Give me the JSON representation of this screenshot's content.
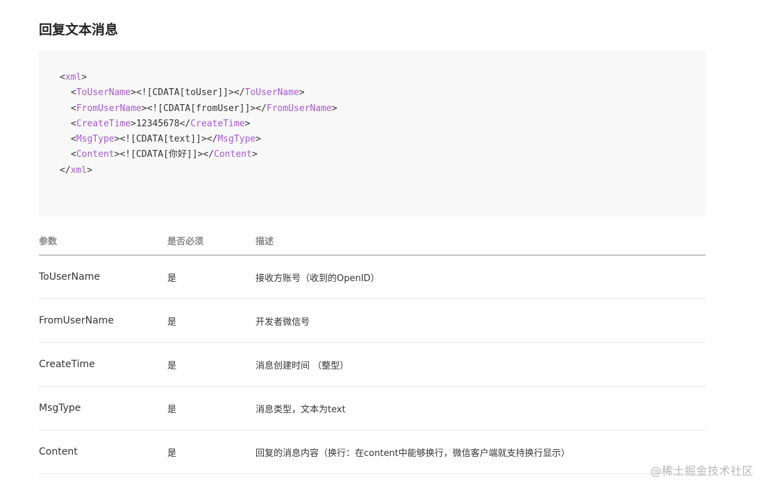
{
  "title": "回复文本消息",
  "code": {
    "lines": [
      {
        "indent": 0,
        "open": "xml",
        "text": "",
        "close": ""
      },
      {
        "indent": 1,
        "open": "ToUserName",
        "text": "<![CDATA[toUser]]>",
        "close": "ToUserName"
      },
      {
        "indent": 1,
        "open": "FromUserName",
        "text": "<![CDATA[fromUser]]>",
        "close": "FromUserName"
      },
      {
        "indent": 1,
        "open": "CreateTime",
        "text": "12345678",
        "close": "CreateTime"
      },
      {
        "indent": 1,
        "open": "MsgType",
        "text": "<![CDATA[text]]>",
        "close": "MsgType"
      },
      {
        "indent": 1,
        "open": "Content",
        "text": "<![CDATA[你好]]>",
        "close": "Content"
      },
      {
        "indent": 0,
        "open": "",
        "text": "",
        "close": "xml"
      }
    ]
  },
  "table": {
    "headers": [
      "参数",
      "是否必须",
      "描述"
    ],
    "rows": [
      {
        "param": "ToUserName",
        "required": "是",
        "desc": "接收方账号（收到的OpenID）"
      },
      {
        "param": "FromUserName",
        "required": "是",
        "desc": "开发者微信号"
      },
      {
        "param": "CreateTime",
        "required": "是",
        "desc": "消息创建时间 （整型）"
      },
      {
        "param": "MsgType",
        "required": "是",
        "desc": "消息类型，文本为text"
      },
      {
        "param": "Content",
        "required": "是",
        "desc": "回复的消息内容（换行：在content中能够换行，微信客户端就支持换行显示）"
      }
    ]
  },
  "watermark": "@稀土掘金技术社区",
  "colors": {
    "tag": "#a757d6",
    "code_bg": "#f8f8f8",
    "header_text": "#888888"
  }
}
